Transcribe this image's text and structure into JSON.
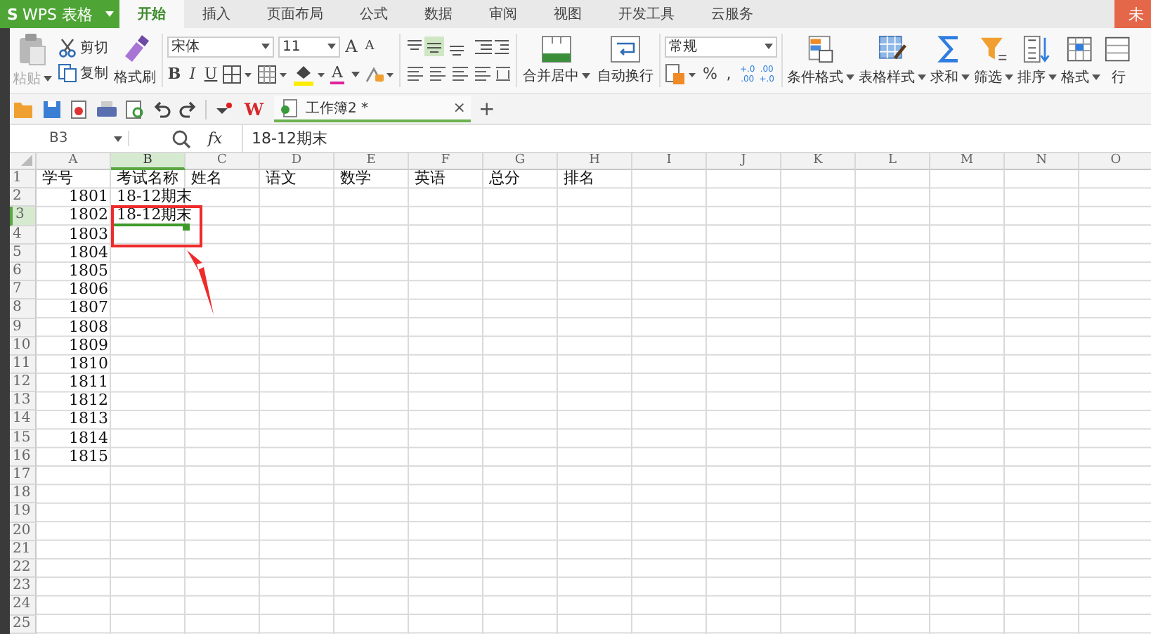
{
  "app": {
    "logo": "S",
    "name": "WPS 表格",
    "account": "未"
  },
  "tabs": [
    {
      "label": "开始",
      "selected": true
    },
    {
      "label": "插入",
      "selected": false
    },
    {
      "label": "页面布局",
      "selected": false
    },
    {
      "label": "公式",
      "selected": false
    },
    {
      "label": "数据",
      "selected": false
    },
    {
      "label": "审阅",
      "selected": false
    },
    {
      "label": "视图",
      "selected": false
    },
    {
      "label": "开发工具",
      "selected": false
    },
    {
      "label": "云服务",
      "selected": false
    }
  ],
  "ribbon": {
    "paste": {
      "label": "粘贴",
      "disabled": true
    },
    "clipboard": [
      {
        "label": "剪切",
        "kind": "cut"
      },
      {
        "label": "复制",
        "kind": "copy"
      }
    ],
    "format_painter": "格式刷",
    "font_name": "宋体",
    "font_size": "11",
    "size_keys": [
      {
        "label": "A",
        "kind": "grow"
      },
      {
        "label": "A",
        "kind": "shrink"
      }
    ],
    "style_keys": [
      {
        "label": "B",
        "kind": "bold"
      },
      {
        "label": "I",
        "kind": "italic"
      },
      {
        "label": "U",
        "kind": "underline"
      }
    ],
    "font_color": "A",
    "merge": "合并居中",
    "wrap": "自动换行",
    "number_format": "常规",
    "number_keys": [
      {
        "top": "%",
        "kind": "single"
      },
      {
        "top": ",",
        "kind": "single"
      },
      {
        "top": "+.0",
        "bottom": ".00",
        "kind": "double"
      },
      {
        "top": ".00",
        "bottom": "+.0",
        "kind": "double"
      }
    ],
    "large_buttons": [
      {
        "label": "条件格式",
        "kind": "conditional"
      },
      {
        "label": "表格样式",
        "kind": "table"
      },
      {
        "label": "求和",
        "kind": "sum"
      },
      {
        "label": "筛选",
        "kind": "filter"
      },
      {
        "label": "排序",
        "kind": "sort"
      },
      {
        "label": "格式",
        "kind": "format"
      },
      {
        "label": "行",
        "kind": "row"
      }
    ]
  },
  "document_tab": {
    "logo": "W",
    "title": "工作簿2 *",
    "close": "×",
    "new": "+"
  },
  "formula_bar": {
    "name_box": "B3",
    "fx": "fx",
    "formula": "18-12期末"
  },
  "sheet": {
    "columns": [
      {
        "label": "A",
        "selected": false
      },
      {
        "label": "B",
        "selected": true
      },
      {
        "label": "C",
        "selected": false
      },
      {
        "label": "D",
        "selected": false
      },
      {
        "label": "E",
        "selected": false
      },
      {
        "label": "F",
        "selected": false
      },
      {
        "label": "G",
        "selected": false
      },
      {
        "label": "H",
        "selected": false
      },
      {
        "label": "I",
        "selected": false
      },
      {
        "label": "J",
        "selected": false
      },
      {
        "label": "K",
        "selected": false
      },
      {
        "label": "L",
        "selected": false
      },
      {
        "label": "M",
        "selected": false
      },
      {
        "label": "N",
        "selected": false
      },
      {
        "label": "O",
        "selected": false
      }
    ],
    "rows": [
      {
        "label": "1",
        "selected": false,
        "cells": [
          {
            "text": "学号",
            "kind": "text",
            "selected": false
          },
          {
            "text": "考试名称",
            "kind": "text",
            "selected": false
          },
          {
            "text": "姓名",
            "kind": "text",
            "selected": false
          },
          {
            "text": "语文",
            "kind": "text",
            "selected": false
          },
          {
            "text": "数学",
            "kind": "text",
            "selected": false
          },
          {
            "text": "英语",
            "kind": "text",
            "selected": false
          },
          {
            "text": "总分",
            "kind": "text",
            "selected": false
          },
          {
            "text": "排名",
            "kind": "text",
            "selected": false
          }
        ]
      },
      {
        "label": "2",
        "selected": false,
        "cells": [
          {
            "text": "1801",
            "kind": "number",
            "selected": false
          },
          {
            "text": "18-12期末",
            "kind": "text",
            "selected": false
          }
        ]
      },
      {
        "label": "3",
        "selected": true,
        "cells": [
          {
            "text": "1802",
            "kind": "number",
            "selected": false
          },
          {
            "text": "18-12期末",
            "kind": "text",
            "selected": true
          }
        ]
      },
      {
        "label": "4",
        "selected": false,
        "cells": [
          {
            "text": "1803",
            "kind": "number",
            "selected": false
          }
        ]
      },
      {
        "label": "5",
        "selected": false,
        "cells": [
          {
            "text": "1804",
            "kind": "number",
            "selected": false
          }
        ]
      },
      {
        "label": "6",
        "selected": false,
        "cells": [
          {
            "text": "1805",
            "kind": "number",
            "selected": false
          }
        ]
      },
      {
        "label": "7",
        "selected": false,
        "cells": [
          {
            "text": "1806",
            "kind": "number",
            "selected": false
          }
        ]
      },
      {
        "label": "8",
        "selected": false,
        "cells": [
          {
            "text": "1807",
            "kind": "number",
            "selected": false
          }
        ]
      },
      {
        "label": "9",
        "selected": false,
        "cells": [
          {
            "text": "1808",
            "kind": "number",
            "selected": false
          }
        ]
      },
      {
        "label": "10",
        "selected": false,
        "cells": [
          {
            "text": "1809",
            "kind": "number",
            "selected": false
          }
        ]
      },
      {
        "label": "11",
        "selected": false,
        "cells": [
          {
            "text": "1810",
            "kind": "number",
            "selected": false
          }
        ]
      },
      {
        "label": "12",
        "selected": false,
        "cells": [
          {
            "text": "1811",
            "kind": "number",
            "selected": false
          }
        ]
      },
      {
        "label": "13",
        "selected": false,
        "cells": [
          {
            "text": "1812",
            "kind": "number",
            "selected": false
          }
        ]
      },
      {
        "label": "14",
        "selected": false,
        "cells": [
          {
            "text": "1813",
            "kind": "number",
            "selected": false
          }
        ]
      },
      {
        "label": "15",
        "selected": false,
        "cells": [
          {
            "text": "1814",
            "kind": "number",
            "selected": false
          }
        ]
      },
      {
        "label": "16",
        "selected": false,
        "cells": [
          {
            "text": "1815",
            "kind": "number",
            "selected": false
          }
        ]
      },
      {
        "label": "17",
        "selected": false
      },
      {
        "label": "18",
        "selected": false
      },
      {
        "label": "19",
        "selected": false
      },
      {
        "label": "20",
        "selected": false
      },
      {
        "label": "21",
        "selected": false
      },
      {
        "label": "22",
        "selected": false
      },
      {
        "label": "23",
        "selected": false
      },
      {
        "label": "24",
        "selected": false
      },
      {
        "label": "25",
        "selected": false
      }
    ]
  }
}
